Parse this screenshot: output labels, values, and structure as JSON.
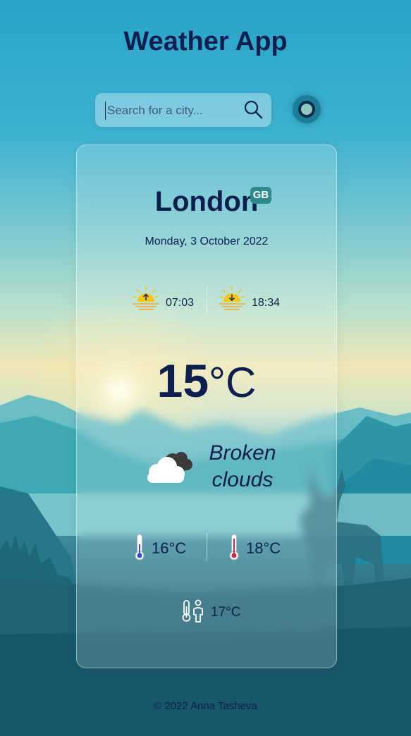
{
  "app": {
    "title": "Weather App"
  },
  "search": {
    "placeholder": "Search for a city...",
    "value": ""
  },
  "icons": {
    "search": "search-icon",
    "theme_toggle": "theme-toggle-icon",
    "sunrise": "sunrise-icon",
    "sunset": "sunset-icon",
    "condition": "broken-clouds-icon",
    "temp_min": "thermometer-cold-icon",
    "temp_max": "thermometer-hot-icon",
    "feels_like": "feels-like-icon"
  },
  "weather": {
    "city": "London",
    "country_code": "GB",
    "date": "Monday, 3 October 2022",
    "sunrise": "07:03",
    "sunset": "18:34",
    "temperature": "15",
    "temperature_unit": "°C",
    "condition_line1": "Broken",
    "condition_line2": "clouds",
    "temp_min": "16°C",
    "temp_max": "18°C",
    "feels_like": "17°C"
  },
  "footer": {
    "text": "© 2022 Anna Tasheva"
  },
  "colors": {
    "text": "#0d1f4f",
    "badge": "#2e8b8b",
    "sun": "#f5c518",
    "toggle": "#1d7c97"
  }
}
